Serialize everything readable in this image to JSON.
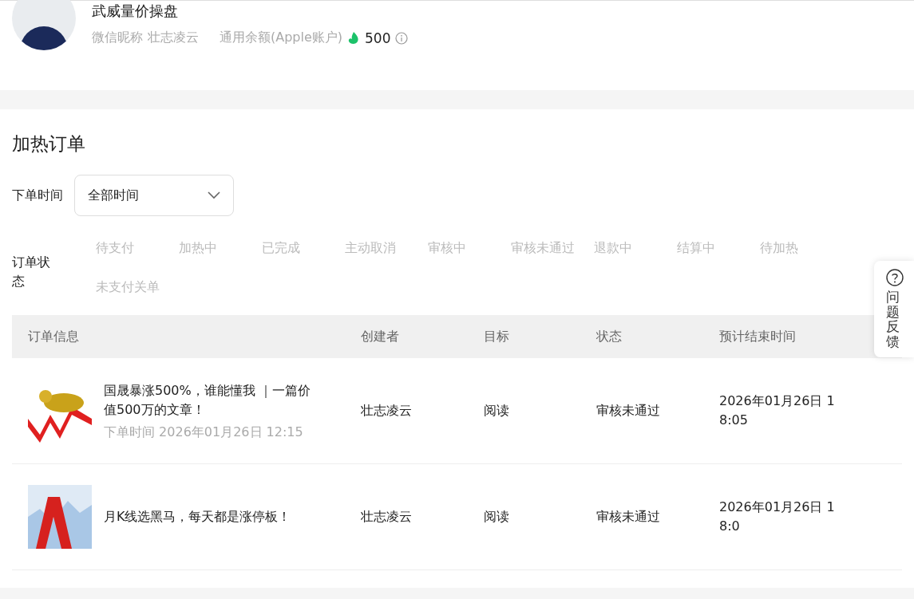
{
  "profile": {
    "name": "武威量价操盘",
    "nickname_label": "微信昵称",
    "nickname": "壮志凌云",
    "balance_label": "通用余额(Apple账户)",
    "balance": "500"
  },
  "orders": {
    "title": "加热订单",
    "time_filter": {
      "label": "下单时间",
      "value": "全部时间"
    },
    "status_filter": {
      "label": "订单状态",
      "options": [
        {
          "label": "待支付",
          "selected": false
        },
        {
          "label": "加热中",
          "selected": false
        },
        {
          "label": "已完成",
          "selected": false
        },
        {
          "label": "主动取消",
          "selected": false
        },
        {
          "label": "审核中",
          "selected": false
        },
        {
          "label": "审核未通过",
          "selected": false
        },
        {
          "label": "退款中",
          "selected": false
        },
        {
          "label": "结算中",
          "selected": false
        },
        {
          "label": "待加热",
          "selected": false
        },
        {
          "label": "未支付关单",
          "selected": false
        }
      ]
    },
    "table": {
      "columns": [
        "订单信息",
        "创建者",
        "目标",
        "状态",
        "预计结束时间"
      ],
      "rows": [
        {
          "kind": "bull",
          "title": "国晟暴涨500%，谁能懂我 ｜一篇价值500万的文章！",
          "order_time": "下单时间 2026年01月26日 12:15",
          "creator": "壮志凌云",
          "target": "阅读",
          "status": "审核未通过",
          "end_time": "2026年01月26日 18:05"
        },
        {
          "kind": "chart",
          "title": "月K线选黑马，每天都是涨停板！",
          "creator": "壮志凌云",
          "target": "阅读",
          "status": "审核未通过",
          "end_time": "2026年01月26日 18:0"
        }
      ]
    }
  },
  "feedback": {
    "label": "问题反馈"
  }
}
